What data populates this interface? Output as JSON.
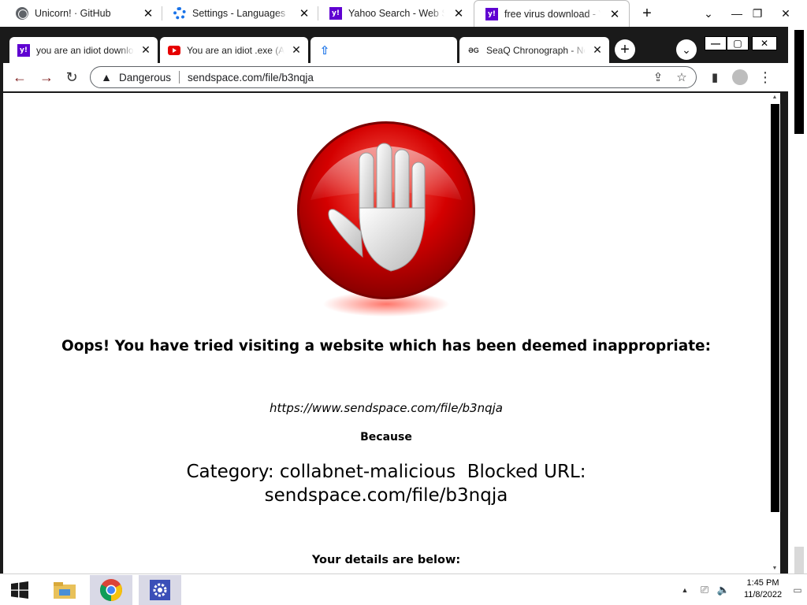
{
  "outer_tabs": [
    {
      "title": "Unicorn! · GitHub",
      "icon": "globe-icon"
    },
    {
      "title": "Settings - Languages",
      "icon": "settings-gear-icon"
    },
    {
      "title": "Yahoo Search - Web Search",
      "icon": "yahoo-icon"
    },
    {
      "title": "free virus download - Yahoo Search",
      "icon": "yahoo-icon",
      "active": true
    }
  ],
  "inner_tabs": [
    {
      "title": "you are an idiot download - Yahoo",
      "icon": "yahoo-icon"
    },
    {
      "title": "You are an idiot .exe (Animated)",
      "icon": "youtube-icon"
    },
    {
      "title": "",
      "icon": "upload-arrow-icon",
      "active": true
    },
    {
      "title": "SeaQ Chronograph - New",
      "icon": "seaq-icon"
    }
  ],
  "address_bar": {
    "security_label": "Dangerous",
    "url": "sendspace.com/file/b3nqja"
  },
  "page": {
    "oops_message": "Oops! You have tried visiting a website which has been deemed inappropriate:",
    "blocked_url": "https://www.sendspace.com/file/b3nqja",
    "because_label": "Because",
    "category_line_1": "Category: collabnet-malicious  Blocked URL:",
    "category_line_2": "sendspace.com/file/b3nqja",
    "details_heading": "Your details are below:"
  },
  "taskbar": {
    "time": "1:45 PM",
    "date": "11/8/2022",
    "apps": [
      "start-icon",
      "file-explorer-icon",
      "chrome-icon",
      "settings-icon"
    ]
  },
  "colors": {
    "yahoo_purple": "#5f01d1",
    "stop_red": "#d40000",
    "chrome_accent": "#1a73e8"
  }
}
